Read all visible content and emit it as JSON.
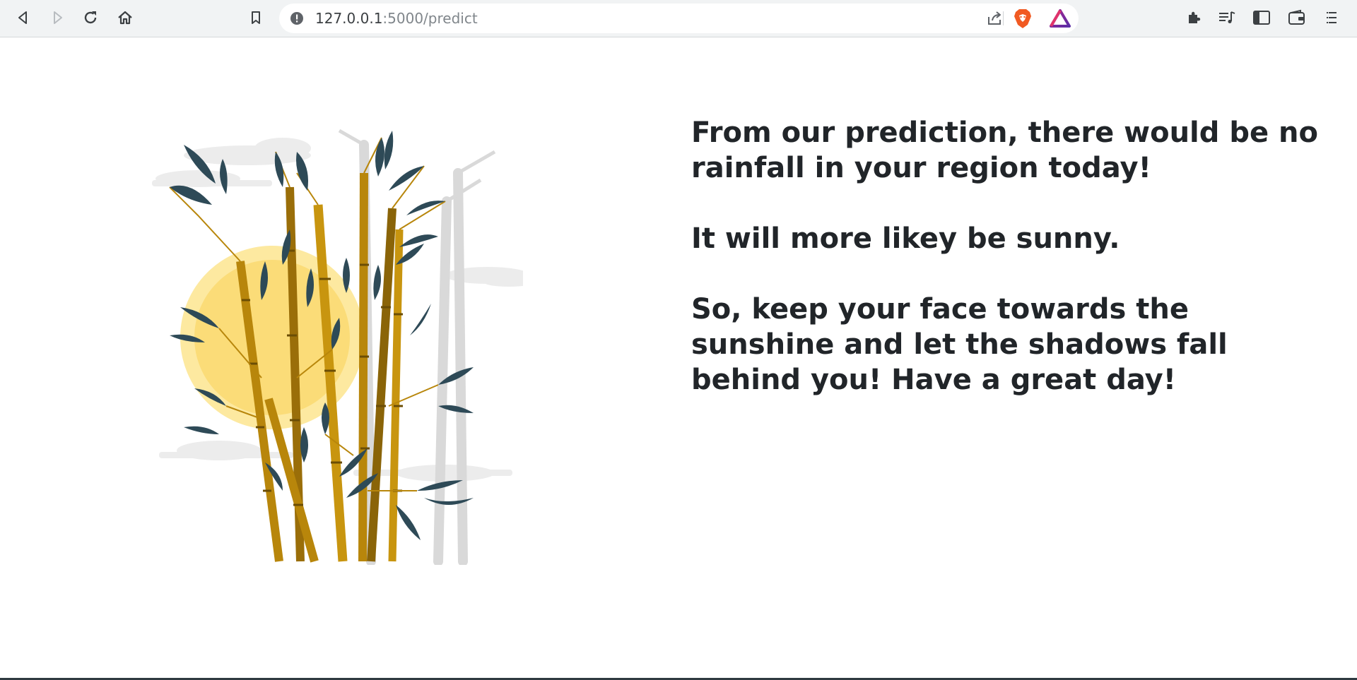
{
  "browser": {
    "url_host": "127.0.0.1",
    "url_rest": ":5000/predict",
    "icons": {
      "back": "back-icon",
      "forward": "forward-icon",
      "reload": "reload-icon",
      "home": "home-icon",
      "bookmark": "bookmark-icon",
      "site_info": "info-icon",
      "share": "share-icon",
      "brave_shields": "brave-shield-icon",
      "brave_rewards": "brave-rewards-icon",
      "extensions": "puzzle-icon",
      "playlist": "playlist-icon",
      "sidebar": "sidebar-icon",
      "wallet": "wallet-icon",
      "menu": "menu-icon"
    }
  },
  "page": {
    "messages": [
      "From our prediction, there would be no rainfall in your region today!",
      "It will more likey be sunny.",
      "So, keep your face towards the sunshine and let the shadows fall behind you! Have a great day!"
    ],
    "illustration": "bamboo-sun-illustration"
  },
  "colors": {
    "text": "#212529",
    "toolbar": "#f1f3f4",
    "sun": "#fde9a0",
    "sun_inner": "#fbdc78",
    "bamboo": "#b8860b",
    "bamboo_dark": "#8a6408",
    "leaf": "#2e4a57",
    "shadow_bamboo": "#d9d9d9"
  }
}
